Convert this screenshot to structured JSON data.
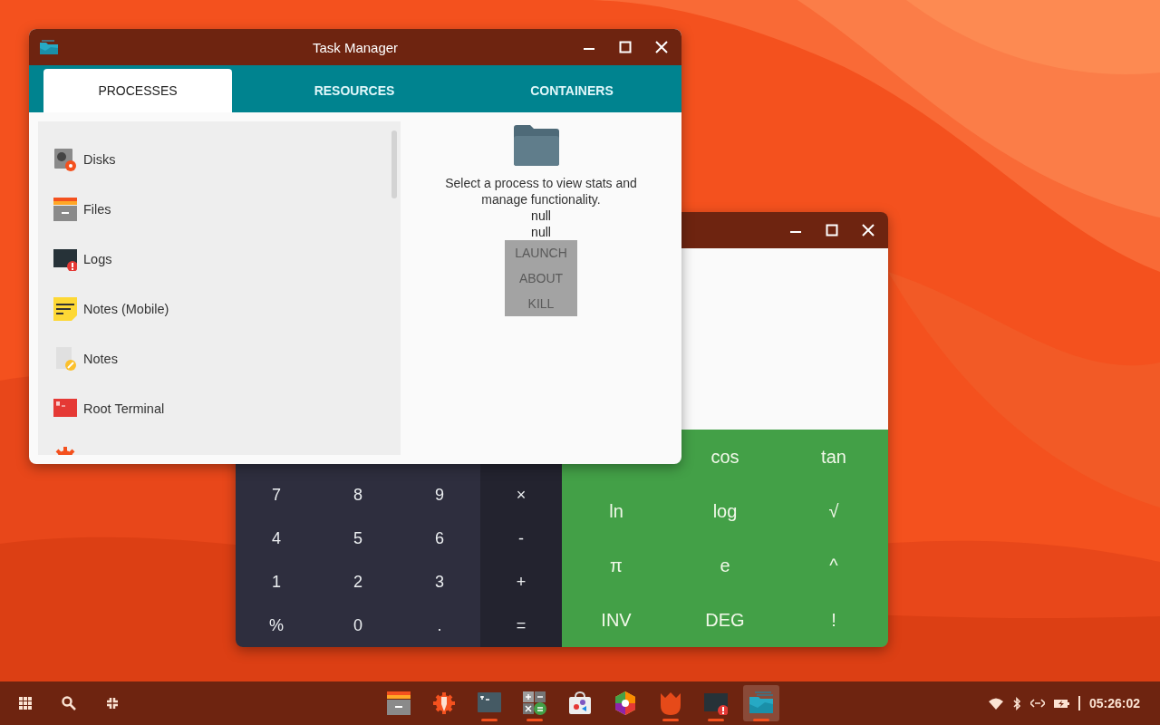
{
  "task_manager": {
    "title": "Task Manager",
    "tabs": [
      {
        "label": "PROCESSES",
        "selected": true
      },
      {
        "label": "RESOURCES",
        "selected": false
      },
      {
        "label": "CONTAINERS",
        "selected": false
      }
    ],
    "processes": [
      {
        "name": "Disks"
      },
      {
        "name": "Files"
      },
      {
        "name": "Logs"
      },
      {
        "name": "Notes (Mobile)"
      },
      {
        "name": "Notes"
      },
      {
        "name": "Root Terminal"
      }
    ],
    "detail": {
      "message": "Select a process to view stats and manage functionality.",
      "lines": [
        "null",
        "null"
      ],
      "buttons": [
        {
          "label": "LAUNCH",
          "disabled": true
        },
        {
          "label": "ABOUT",
          "disabled": true
        },
        {
          "label": "KILL",
          "disabled": true
        }
      ]
    }
  },
  "calculator": {
    "digit_keys": [
      [
        "7",
        "8",
        "9"
      ],
      [
        "4",
        "5",
        "6"
      ],
      [
        "1",
        "2",
        "3"
      ],
      [
        "%",
        "0",
        "."
      ]
    ],
    "operator_keys": [
      "×",
      "-",
      "+",
      "="
    ],
    "function_keys": [
      [
        "cos",
        "tan"
      ],
      [
        "ln",
        "log",
        "√"
      ],
      [
        "π",
        "e",
        "^"
      ],
      [
        "INV",
        "DEG",
        "!"
      ]
    ]
  },
  "taskbar": {
    "apps": [
      {
        "running": false,
        "selected": false
      },
      {
        "running": false,
        "selected": false
      },
      {
        "running": true,
        "selected": false
      },
      {
        "running": true,
        "selected": false
      },
      {
        "running": false,
        "selected": false
      },
      {
        "running": false,
        "selected": false
      },
      {
        "running": true,
        "selected": false
      },
      {
        "running": true,
        "selected": false
      },
      {
        "running": true,
        "selected": true
      }
    ],
    "clock": "05:26:02"
  }
}
